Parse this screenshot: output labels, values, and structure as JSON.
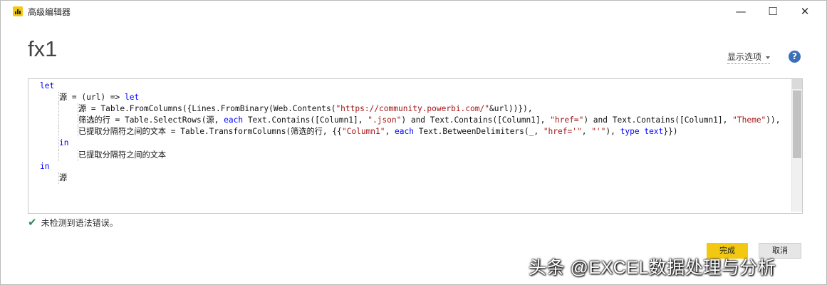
{
  "window": {
    "title": "高级编辑器",
    "controls": {
      "minimize": "—",
      "maximize": "☐",
      "close": "✕"
    }
  },
  "query_name": "fx1",
  "display_options_label": "显示选项",
  "help_label": "?",
  "code_lines": [
    {
      "indent": 0,
      "tokens": [
        {
          "t": "let",
          "c": "kw"
        }
      ]
    },
    {
      "indent": 1,
      "tokens": [
        {
          "t": "源 = (url) => "
        },
        {
          "t": "let",
          "c": "kw"
        }
      ]
    },
    {
      "indent": 2,
      "tokens": [
        {
          "t": "源 = Table.FromColumns({Lines.FromBinary(Web.Contents("
        },
        {
          "t": "\"https://community.powerbi.com/\"",
          "c": "str"
        },
        {
          "t": "&url))}),"
        }
      ]
    },
    {
      "indent": 2,
      "tokens": [
        {
          "t": "筛选的行 = Table.SelectRows(源, "
        },
        {
          "t": "each",
          "c": "kw"
        },
        {
          "t": " Text.Contains([Column1], "
        },
        {
          "t": "\".json\"",
          "c": "str"
        },
        {
          "t": ") and Text.Contains([Column1], "
        },
        {
          "t": "\"href=\"",
          "c": "str"
        },
        {
          "t": ") and Text.Contains([Column1], "
        },
        {
          "t": "\"Theme\"",
          "c": "str"
        },
        {
          "t": ")),"
        }
      ]
    },
    {
      "indent": 2,
      "tokens": [
        {
          "t": "已提取分隔符之间的文本 = Table.TransformColumns(筛选的行, {{"
        },
        {
          "t": "\"Column1\"",
          "c": "str"
        },
        {
          "t": ", "
        },
        {
          "t": "each",
          "c": "kw"
        },
        {
          "t": " Text.BetweenDelimiters(_, "
        },
        {
          "t": "\"href='\"",
          "c": "str"
        },
        {
          "t": ", "
        },
        {
          "t": "\"'\"",
          "c": "str"
        },
        {
          "t": "), "
        },
        {
          "t": "type",
          "c": "kw"
        },
        {
          "t": " "
        },
        {
          "t": "text",
          "c": "kw"
        },
        {
          "t": "}})"
        }
      ]
    },
    {
      "indent": 1,
      "tokens": [
        {
          "t": "in",
          "c": "kw"
        }
      ]
    },
    {
      "indent": 2,
      "tokens": [
        {
          "t": "已提取分隔符之间的文本"
        }
      ]
    },
    {
      "indent": 0,
      "tokens": [
        {
          "t": "in",
          "c": "kw"
        }
      ]
    },
    {
      "indent": 1,
      "tokens": [
        {
          "t": "源"
        }
      ]
    }
  ],
  "status_message": "未检测到语法错误。",
  "buttons": {
    "done": "完成",
    "cancel": "取消"
  },
  "watermark": "头条 @EXCEL数据处理与分析",
  "colors": {
    "accent": "#f2c811",
    "keyword": "#0000ff",
    "string": "#a31515",
    "help": "#3b70b8",
    "ok": "#2e8b57"
  }
}
